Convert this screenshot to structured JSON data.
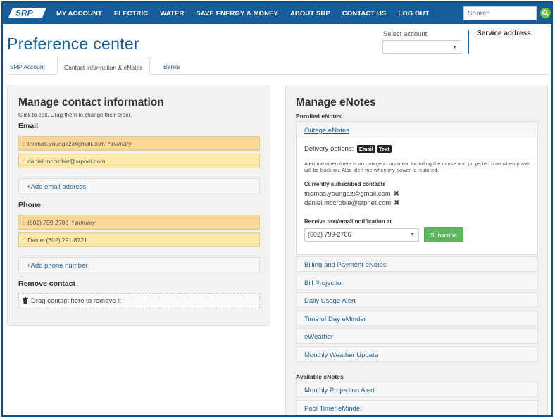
{
  "nav": {
    "logo_text": "SRP",
    "items": [
      "MY ACCOUNT",
      "ELECTRIC",
      "WATER",
      "SAVE ENERGY & MONEY",
      "ABOUT SRP",
      "CONTACT US",
      "LOG OUT"
    ],
    "search_placeholder": "Search"
  },
  "header": {
    "title": "Preference center",
    "select_account_label": "Select account:",
    "service_address_label": "Service address:"
  },
  "tabs": [
    "SRP Account",
    "Contact Information & eNotes",
    "Banks"
  ],
  "contact": {
    "title": "Manage contact information",
    "hint": "Click to edit. Drag them to change their order.",
    "email_label": "Email",
    "emails": [
      {
        "text": ":: thomas.youngaz@gmail.com",
        "primary": "* primary"
      },
      {
        "text": ":: daniel.mccrobie@srpnet.com",
        "primary": ""
      }
    ],
    "add_email": "+Add email address",
    "phone_label": "Phone",
    "phones": [
      {
        "text": ":: (602) 799-2786",
        "primary": "* primary"
      },
      {
        "text": ":: Daniel (602) 291-8721",
        "primary": ""
      }
    ],
    "add_phone": "+Add phone number",
    "remove_label": "Remove contact",
    "drop_text": "Drag contact here to remove it"
  },
  "enotes": {
    "title": "Manage eNotes",
    "enrolled_label": "Enrolled eNotes",
    "open_enote": {
      "name": "Outage eNotes",
      "delivery_label": "Delivery options:",
      "chips": [
        "Email",
        "Text"
      ],
      "description": "Alert me when there is an outage in my area, including the cause and projected time when power will be back on. Also alert me when my power is restored.",
      "subscribed_label": "Currently subscribed contacts",
      "subscribed": [
        "thomas.youngaz@gmail.com",
        "daniel.mccrobie@srpnet.com"
      ],
      "receive_label": "Receive text/email notification at",
      "receive_value": "(602) 799-2786",
      "subscribe_label": "Subscribe"
    },
    "enrolled": [
      "Billing and Payment eNotes",
      "Bill Projection",
      "Daily Usage Alert",
      "Time of Day eMinder",
      "eWeather",
      "Monthly Weather Update"
    ],
    "available_label": "Available eNotes",
    "available": [
      "Monthly Projection Alert",
      "Pool Timer eMinder"
    ]
  }
}
